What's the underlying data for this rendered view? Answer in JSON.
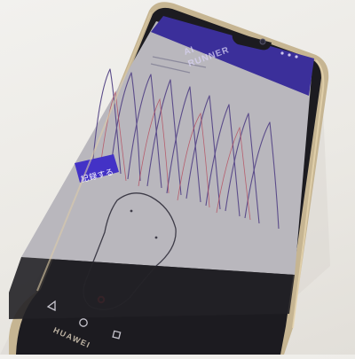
{
  "app": {
    "title": "AI RUNNER",
    "record_button_label": "記録する"
  },
  "device": {
    "brand": "HUAWEI"
  },
  "colors": {
    "header_purple": "#3b2f9a",
    "button_purple": "#4332c6",
    "screen_bg": "#b9b7bd",
    "phone_frame": "#c9b89a",
    "waveform_line": "#5b4c8a",
    "pressure_point_red": "#d12a36"
  },
  "nav_bar_icons": [
    "back-triangle-icon",
    "home-circle-icon",
    "recents-square-icon"
  ]
}
